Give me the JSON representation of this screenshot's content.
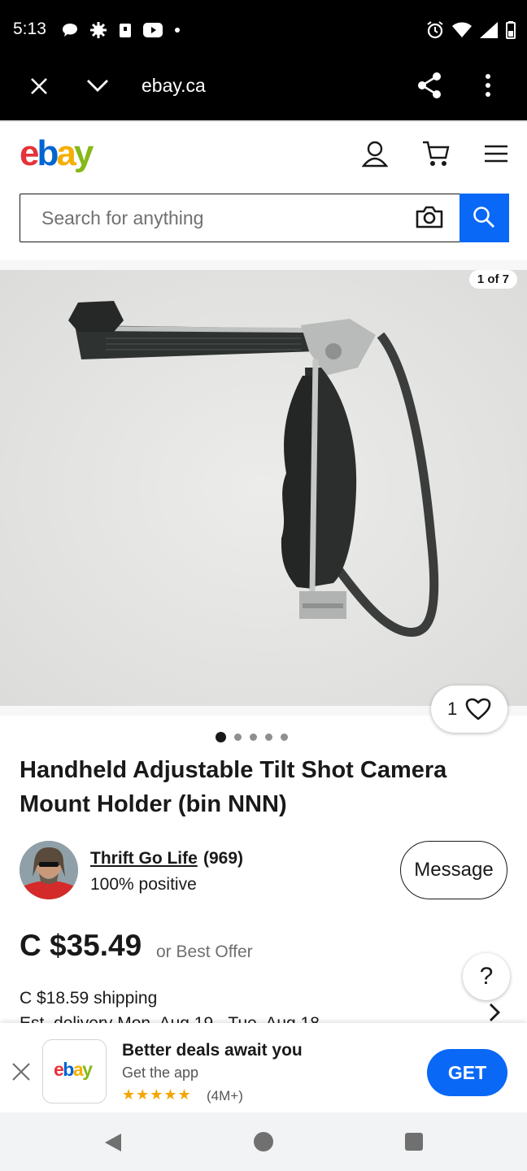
{
  "status_bar": {
    "time": "5:13"
  },
  "browser": {
    "url": "ebay.ca"
  },
  "header": {
    "logo": {
      "e": "e",
      "b": "b",
      "a": "a",
      "y": "y"
    },
    "search_placeholder": "Search for anything"
  },
  "gallery": {
    "counter": "1 of 7",
    "watch_count": "1",
    "dots_total": 5,
    "dots_active": 1
  },
  "listing": {
    "title": "Handheld Adjustable Tilt Shot Camera Mount Holder (bin NNN)",
    "seller_name": "Thrift Go Life",
    "seller_count": "(969)",
    "seller_positive": "100% positive",
    "message_label": "Message",
    "price": "C $35.49",
    "best_offer": "or Best Offer",
    "help_label": "?",
    "shipping": "C $18.59 shipping",
    "delivery": "Est. delivery Mon, Aug 19 - Tue, Aug 18"
  },
  "app_banner": {
    "logo_text": {
      "e": "e",
      "b": "b",
      "a": "a",
      "y": "y"
    },
    "headline": "Better deals await you",
    "subtitle": "Get the app",
    "stars": "★★★★★",
    "rating": "(4M+)",
    "get_label": "GET"
  },
  "colors": {
    "ebay_red": "#e53238",
    "ebay_blue": "#0064d2",
    "ebay_yellow": "#f5af02",
    "ebay_green": "#86b817",
    "accent_blue": "#0968f6"
  }
}
